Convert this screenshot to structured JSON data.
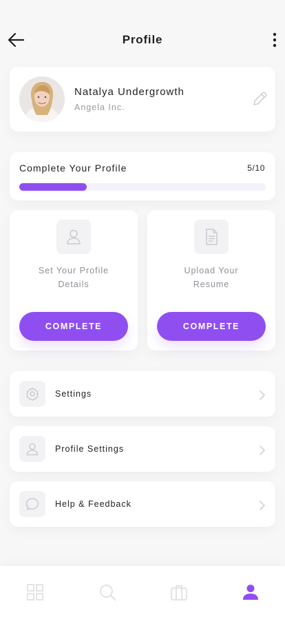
{
  "header": {
    "title": "Profile",
    "back_icon": "arrow-left-icon",
    "more_icon": "more-vertical-icon"
  },
  "profile": {
    "name": "Natalya Undergrowth",
    "company": "Angela Inc.",
    "avatar_icon": "avatar-photo",
    "edit_icon": "pencil-icon"
  },
  "progress": {
    "title": "Complete Your Profile",
    "count": "5/10",
    "completed": 5,
    "total": 10
  },
  "tasks": [
    {
      "label": "Set Your Profile\nDetails",
      "icon": "user-icon",
      "button_label": "COMPLETE"
    },
    {
      "label": "Upload Your\nResume",
      "icon": "document-icon",
      "button_label": "COMPLETE"
    }
  ],
  "menu": [
    {
      "label": "Settings",
      "icon": "gear-icon"
    },
    {
      "label": "Profile Settings",
      "icon": "user-icon"
    },
    {
      "label": "Help & Feedback",
      "icon": "chat-bubble-icon"
    }
  ],
  "bottom_nav": [
    {
      "icon": "grid-icon",
      "active": false
    },
    {
      "icon": "search-icon",
      "active": false
    },
    {
      "icon": "briefcase-icon",
      "active": false
    },
    {
      "icon": "profile-icon",
      "active": true
    }
  ],
  "colors": {
    "accent": "#8f4ff0",
    "inactive_icon": "#e3e3e7",
    "icon_box": "#f2f2f4",
    "text_primary": "#1f1f24",
    "text_secondary": "#9a9aa3"
  }
}
